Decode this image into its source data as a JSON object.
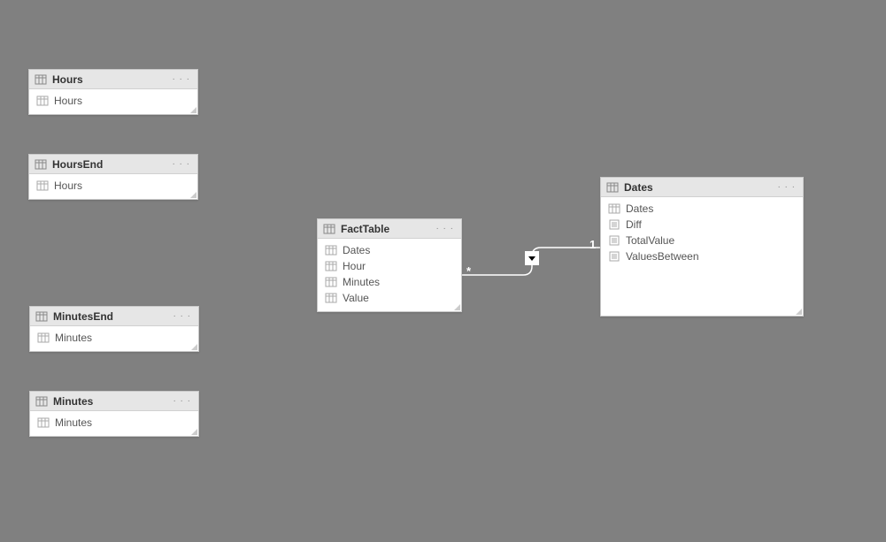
{
  "tables": {
    "hours": {
      "title": "Hours",
      "fields": [
        {
          "name": "Hours",
          "type": "column"
        }
      ]
    },
    "hoursEnd": {
      "title": "HoursEnd",
      "fields": [
        {
          "name": "Hours",
          "type": "column"
        }
      ]
    },
    "minutesEnd": {
      "title": "MinutesEnd",
      "fields": [
        {
          "name": "Minutes",
          "type": "column"
        }
      ]
    },
    "minutes": {
      "title": "Minutes",
      "fields": [
        {
          "name": "Minutes",
          "type": "column"
        }
      ]
    },
    "factTable": {
      "title": "FactTable",
      "fields": [
        {
          "name": "Dates",
          "type": "column"
        },
        {
          "name": "Hour",
          "type": "column"
        },
        {
          "name": "Minutes",
          "type": "column"
        },
        {
          "name": "Value",
          "type": "column"
        }
      ]
    },
    "dates": {
      "title": "Dates",
      "fields": [
        {
          "name": "Dates",
          "type": "column"
        },
        {
          "name": "Diff",
          "type": "measure"
        },
        {
          "name": "TotalValue",
          "type": "measure"
        },
        {
          "name": "ValuesBetween",
          "type": "measure"
        }
      ]
    }
  },
  "relationship": {
    "from": "factTable",
    "to": "dates",
    "from_card": "*",
    "to_card": "1"
  },
  "ui": {
    "more_glyph": "· · ·"
  }
}
